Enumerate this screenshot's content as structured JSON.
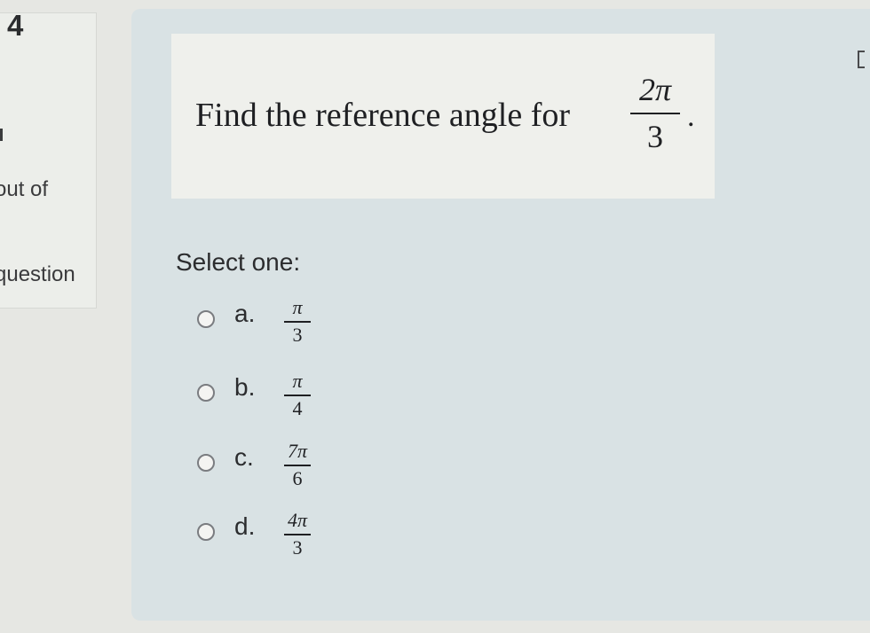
{
  "info": {
    "question_number": "4",
    "out_of_fragment": "out of",
    "flag_fragment": "question"
  },
  "question": {
    "text": "Find the reference angle for",
    "fraction": {
      "numerator": "2π",
      "denominator": "3"
    },
    "period": "."
  },
  "prompt": "Select one:",
  "options": [
    {
      "letter": "a.",
      "numerator": "π",
      "denominator": "3"
    },
    {
      "letter": "b.",
      "numerator": "π",
      "denominator": "4"
    },
    {
      "letter": "c.",
      "numerator": "7π",
      "denominator": "6"
    },
    {
      "letter": "d.",
      "numerator": "4π",
      "denominator": "3"
    }
  ],
  "icons": {
    "radio": "radio-button-icon"
  }
}
